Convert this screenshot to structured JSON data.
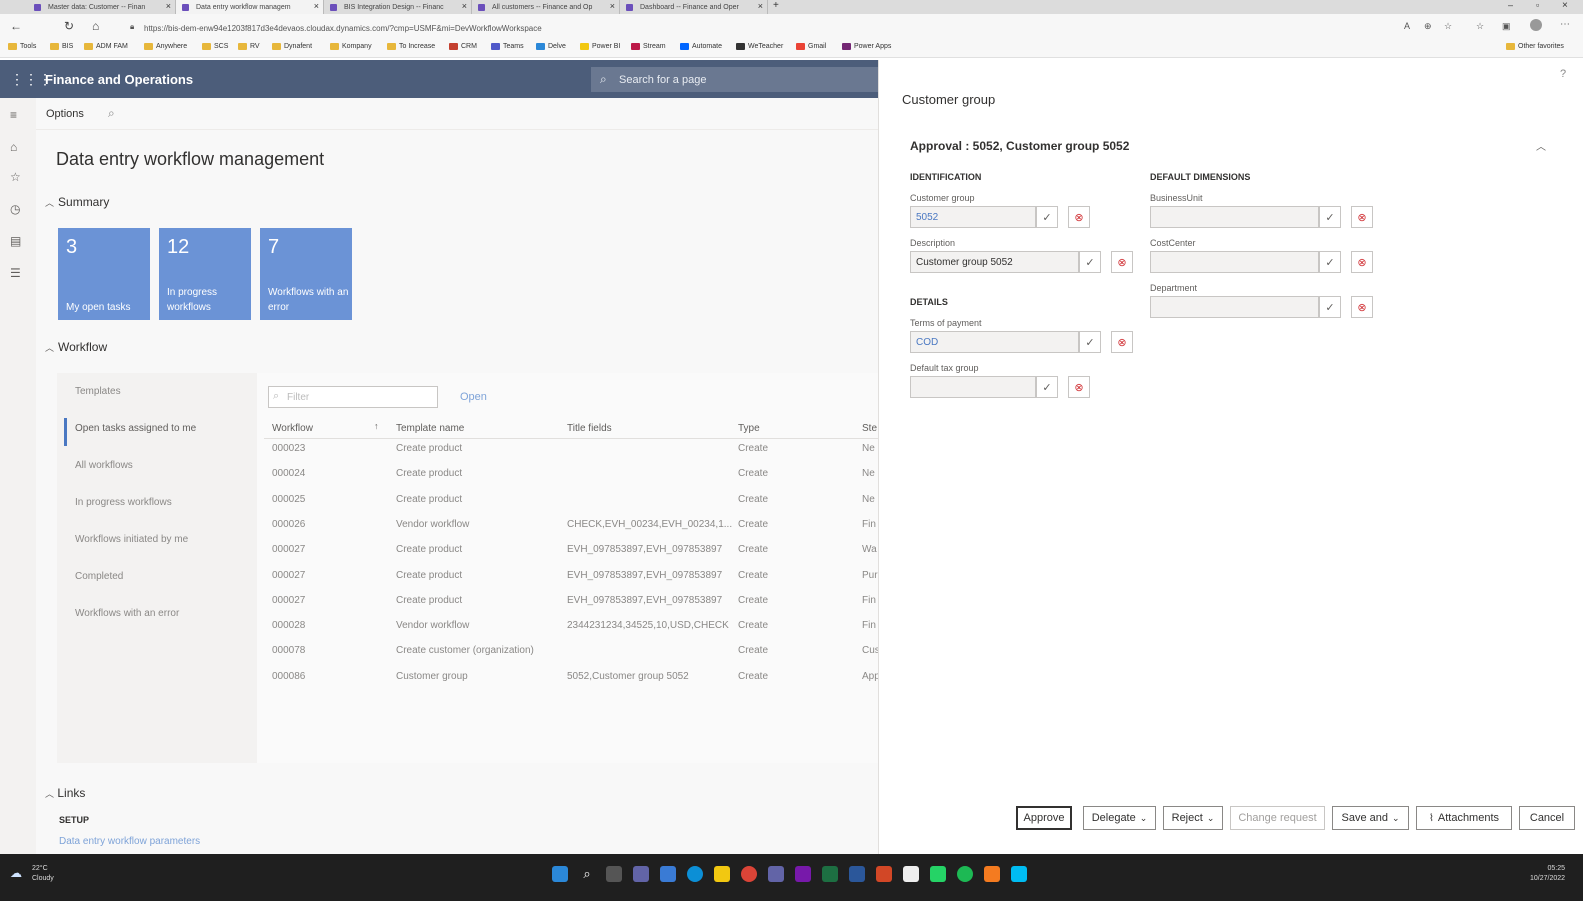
{
  "browser": {
    "tabs": [
      {
        "label": "Master data: Customer -- Finan"
      },
      {
        "label": "Data entry workflow managem"
      },
      {
        "label": "BIS Integration Design -- Financ"
      },
      {
        "label": "All customers -- Finance and Op"
      },
      {
        "label": "Dashboard -- Finance and Oper"
      }
    ],
    "url": "https://bis-dem-enw94e1203f817d3e4devaos.cloudax.dynamics.com/?cmp=USMF&mi=DevWorkflowWorkspace",
    "favorites": [
      "Tools",
      "BIS",
      "ADM FAM",
      "Anywhere",
      "SCS",
      "RV",
      "Dynafent",
      "Kompany",
      "To Increase",
      "CRM",
      "Teams",
      "Delve",
      "Power BI",
      "Stream",
      "Automate",
      "WeTeacher",
      "Gmail",
      "Power Apps"
    ],
    "other_favorites": "Other favorites"
  },
  "app": {
    "title": "Finance and Operations",
    "search_placeholder": "Search for a page"
  },
  "cmdbar": {
    "options": "Options"
  },
  "page": {
    "title": "Data entry workflow management",
    "summary_label": "Summary",
    "tiles": [
      {
        "number": "3",
        "label": "My open tasks"
      },
      {
        "number": "12",
        "label": "In progress workflows"
      },
      {
        "number": "7",
        "label": "Workflows with an error"
      }
    ],
    "workflow_label": "Workflow",
    "nav": [
      "Templates",
      "Open tasks assigned to me",
      "All workflows",
      "In progress workflows",
      "Workflows initiated by me",
      "Completed",
      "Workflows with an error"
    ],
    "filter_placeholder": "Filter",
    "open_label": "Open",
    "columns": [
      "Workflow",
      "Template name",
      "Title fields",
      "Type",
      "Ste"
    ],
    "rows": [
      [
        "000023",
        "Create product",
        "",
        "Create",
        "Ne"
      ],
      [
        "000024",
        "Create product",
        "",
        "Create",
        "Ne"
      ],
      [
        "000025",
        "Create product",
        "",
        "Create",
        "Ne"
      ],
      [
        "000026",
        "Vendor workflow",
        "CHECK,EVH_00234,EVH_00234,1...",
        "Create",
        "Fin"
      ],
      [
        "000027",
        "Create product",
        "EVH_097853897,EVH_097853897",
        "Create",
        "Wa"
      ],
      [
        "000027",
        "Create product",
        "EVH_097853897,EVH_097853897",
        "Create",
        "Pur"
      ],
      [
        "000027",
        "Create product",
        "EVH_097853897,EVH_097853897",
        "Create",
        "Fin"
      ],
      [
        "000028",
        "Vendor workflow",
        "2344231234,34525,10,USD,CHECK",
        "Create",
        "Fin"
      ],
      [
        "000078",
        "Create customer (organization)",
        "",
        "Create",
        "Cus"
      ],
      [
        "000086",
        "Customer group",
        "5052,Customer group 5052",
        "Create",
        "App"
      ]
    ],
    "links_label": "Links",
    "setup_label": "SETUP",
    "setup_link": "Data entry workflow parameters"
  },
  "dialog": {
    "title": "Customer group",
    "subtitle": "Approval : 5052, Customer group 5052",
    "identification": "IDENTIFICATION",
    "customer_group_label": "Customer group",
    "customer_group_value": "5052",
    "description_label": "Description",
    "description_value": "Customer group 5052",
    "details": "DETAILS",
    "terms_label": "Terms of payment",
    "terms_value": "COD",
    "tax_label": "Default tax group",
    "tax_value": "",
    "default_dimensions": "DEFAULT DIMENSIONS",
    "bu_label": "BusinessUnit",
    "cc_label": "CostCenter",
    "dept_label": "Department",
    "buttons": {
      "approve": "Approve",
      "delegate": "Delegate",
      "reject": "Reject",
      "change_request": "Change request",
      "save_and": "Save and",
      "attachments": "Attachments",
      "cancel": "Cancel"
    }
  },
  "taskbar": {
    "temp": "22°C",
    "weather": "Cloudy",
    "time": "05:25",
    "date": "10/27/2022"
  }
}
